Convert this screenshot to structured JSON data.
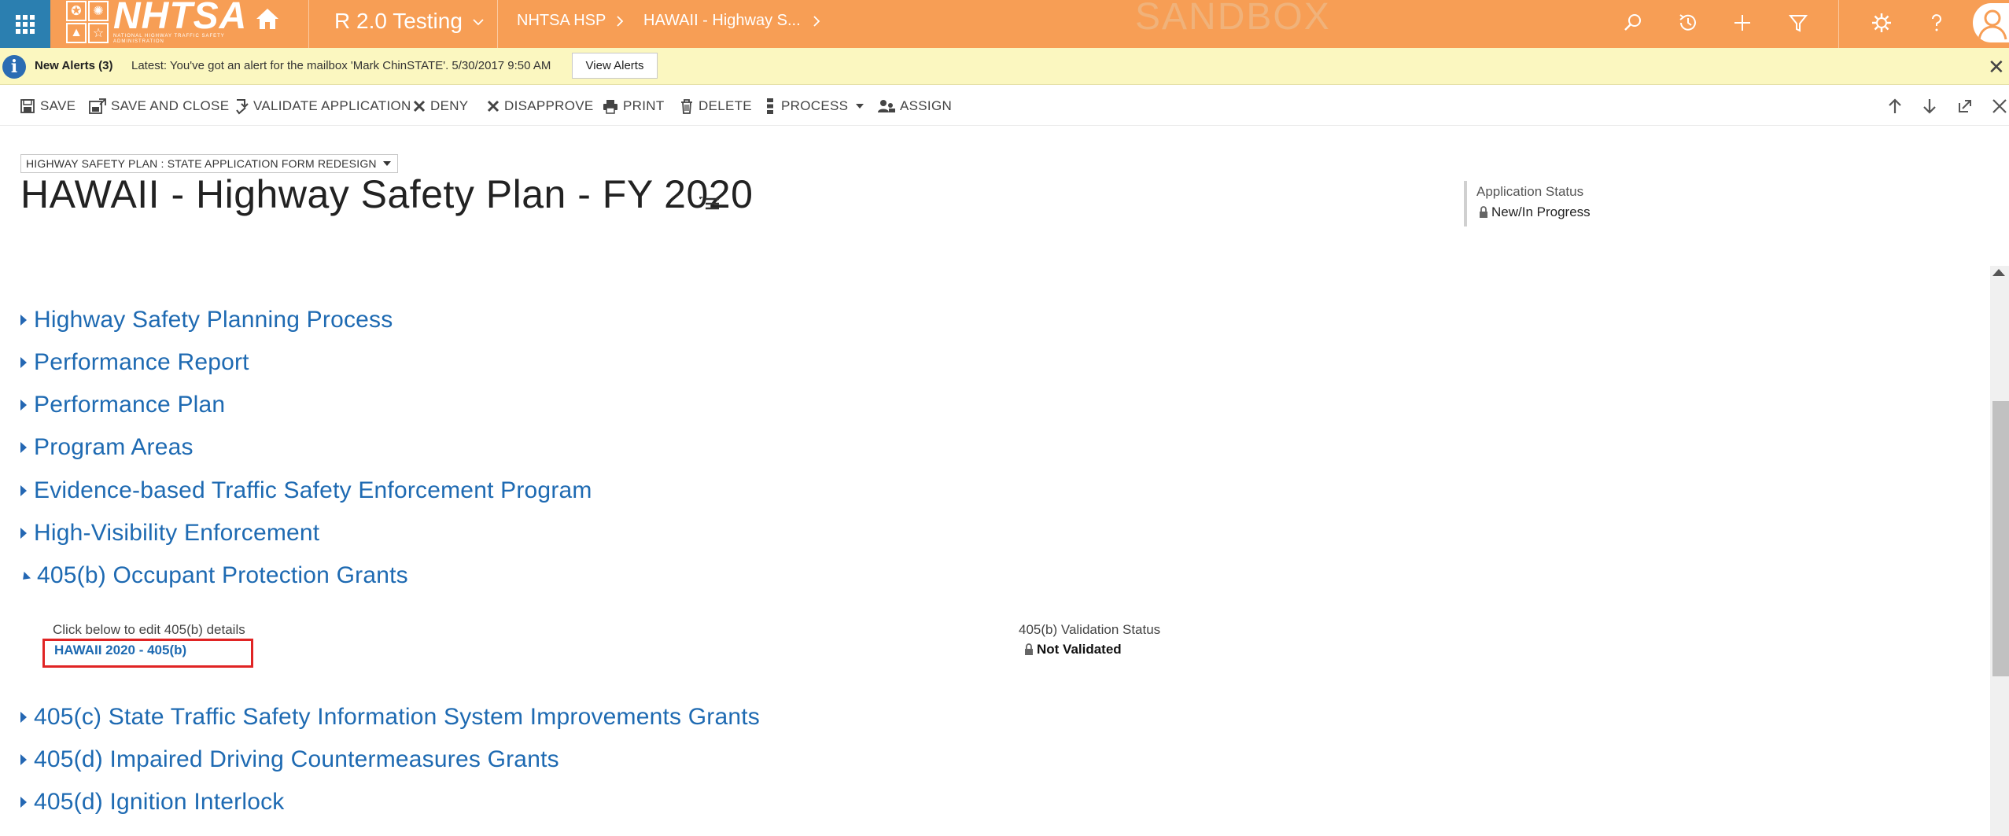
{
  "topbar": {
    "logo_text": "NHTSA",
    "logo_subtext": "NATIONAL HIGHWAY TRAFFIC SAFETY ADMINISTRATION",
    "app_name": "R 2.0 Testing",
    "breadcrumbs": [
      "NHTSA HSP",
      "HAWAII - Highway S..."
    ],
    "environment_watermark": "SANDBOX",
    "icons": [
      "waffle-icon",
      "home-icon",
      "search-icon",
      "history-icon",
      "plus-icon",
      "filter-icon",
      "gear-icon",
      "help-icon",
      "user-avatar-icon"
    ],
    "colors": {
      "bar": "#f79e55",
      "waffle": "#2b7fb0"
    }
  },
  "alert": {
    "title": "New Alerts (3)",
    "message": "Latest: You've got an alert for the mailbox 'Mark ChinSTATE'. 5/30/2017 9:50 AM",
    "button_label": "View Alerts",
    "close_symbol": "✕"
  },
  "commands": {
    "save": "SAVE",
    "save_and_close": "SAVE AND CLOSE",
    "validate": "VALIDATE APPLICATION",
    "deny": "DENY",
    "disapprove": "DISAPPROVE",
    "print": "PRINT",
    "delete": "DELETE",
    "process": "PROCESS",
    "assign": "ASSIGN"
  },
  "header": {
    "form_selector": "HIGHWAY SAFETY PLAN : STATE APPLICATION FORM REDESIGN",
    "title": "HAWAII - Highway Safety Plan - FY 2020",
    "status_label": "Application Status",
    "status_value": "New/In Progress"
  },
  "sections": [
    {
      "label": "Highway Safety Planning Process",
      "expanded": false
    },
    {
      "label": "Performance Report",
      "expanded": false
    },
    {
      "label": "Performance Plan",
      "expanded": false
    },
    {
      "label": "Program Areas",
      "expanded": false
    },
    {
      "label": "Evidence-based Traffic Safety Enforcement Program",
      "expanded": false
    },
    {
      "label": "High-Visibility Enforcement",
      "expanded": false
    },
    {
      "label": "405(b) Occupant Protection Grants",
      "expanded": true
    },
    {
      "label": "405(c) State Traffic Safety Information System Improvements Grants",
      "expanded": false
    },
    {
      "label": "405(d) Impaired Driving Countermeasures Grants",
      "expanded": false
    },
    {
      "label": "405(d) Ignition Interlock",
      "expanded": false
    }
  ],
  "section_405b": {
    "edit_label": "Click below to edit 405(b) details",
    "link_text": "HAWAII 2020 - 405(b)",
    "validation_label": "405(b) Validation Status",
    "validation_value": "Not Validated"
  },
  "accent_colors": {
    "link": "#1e6ab2",
    "highlight_box": "#e02424"
  }
}
